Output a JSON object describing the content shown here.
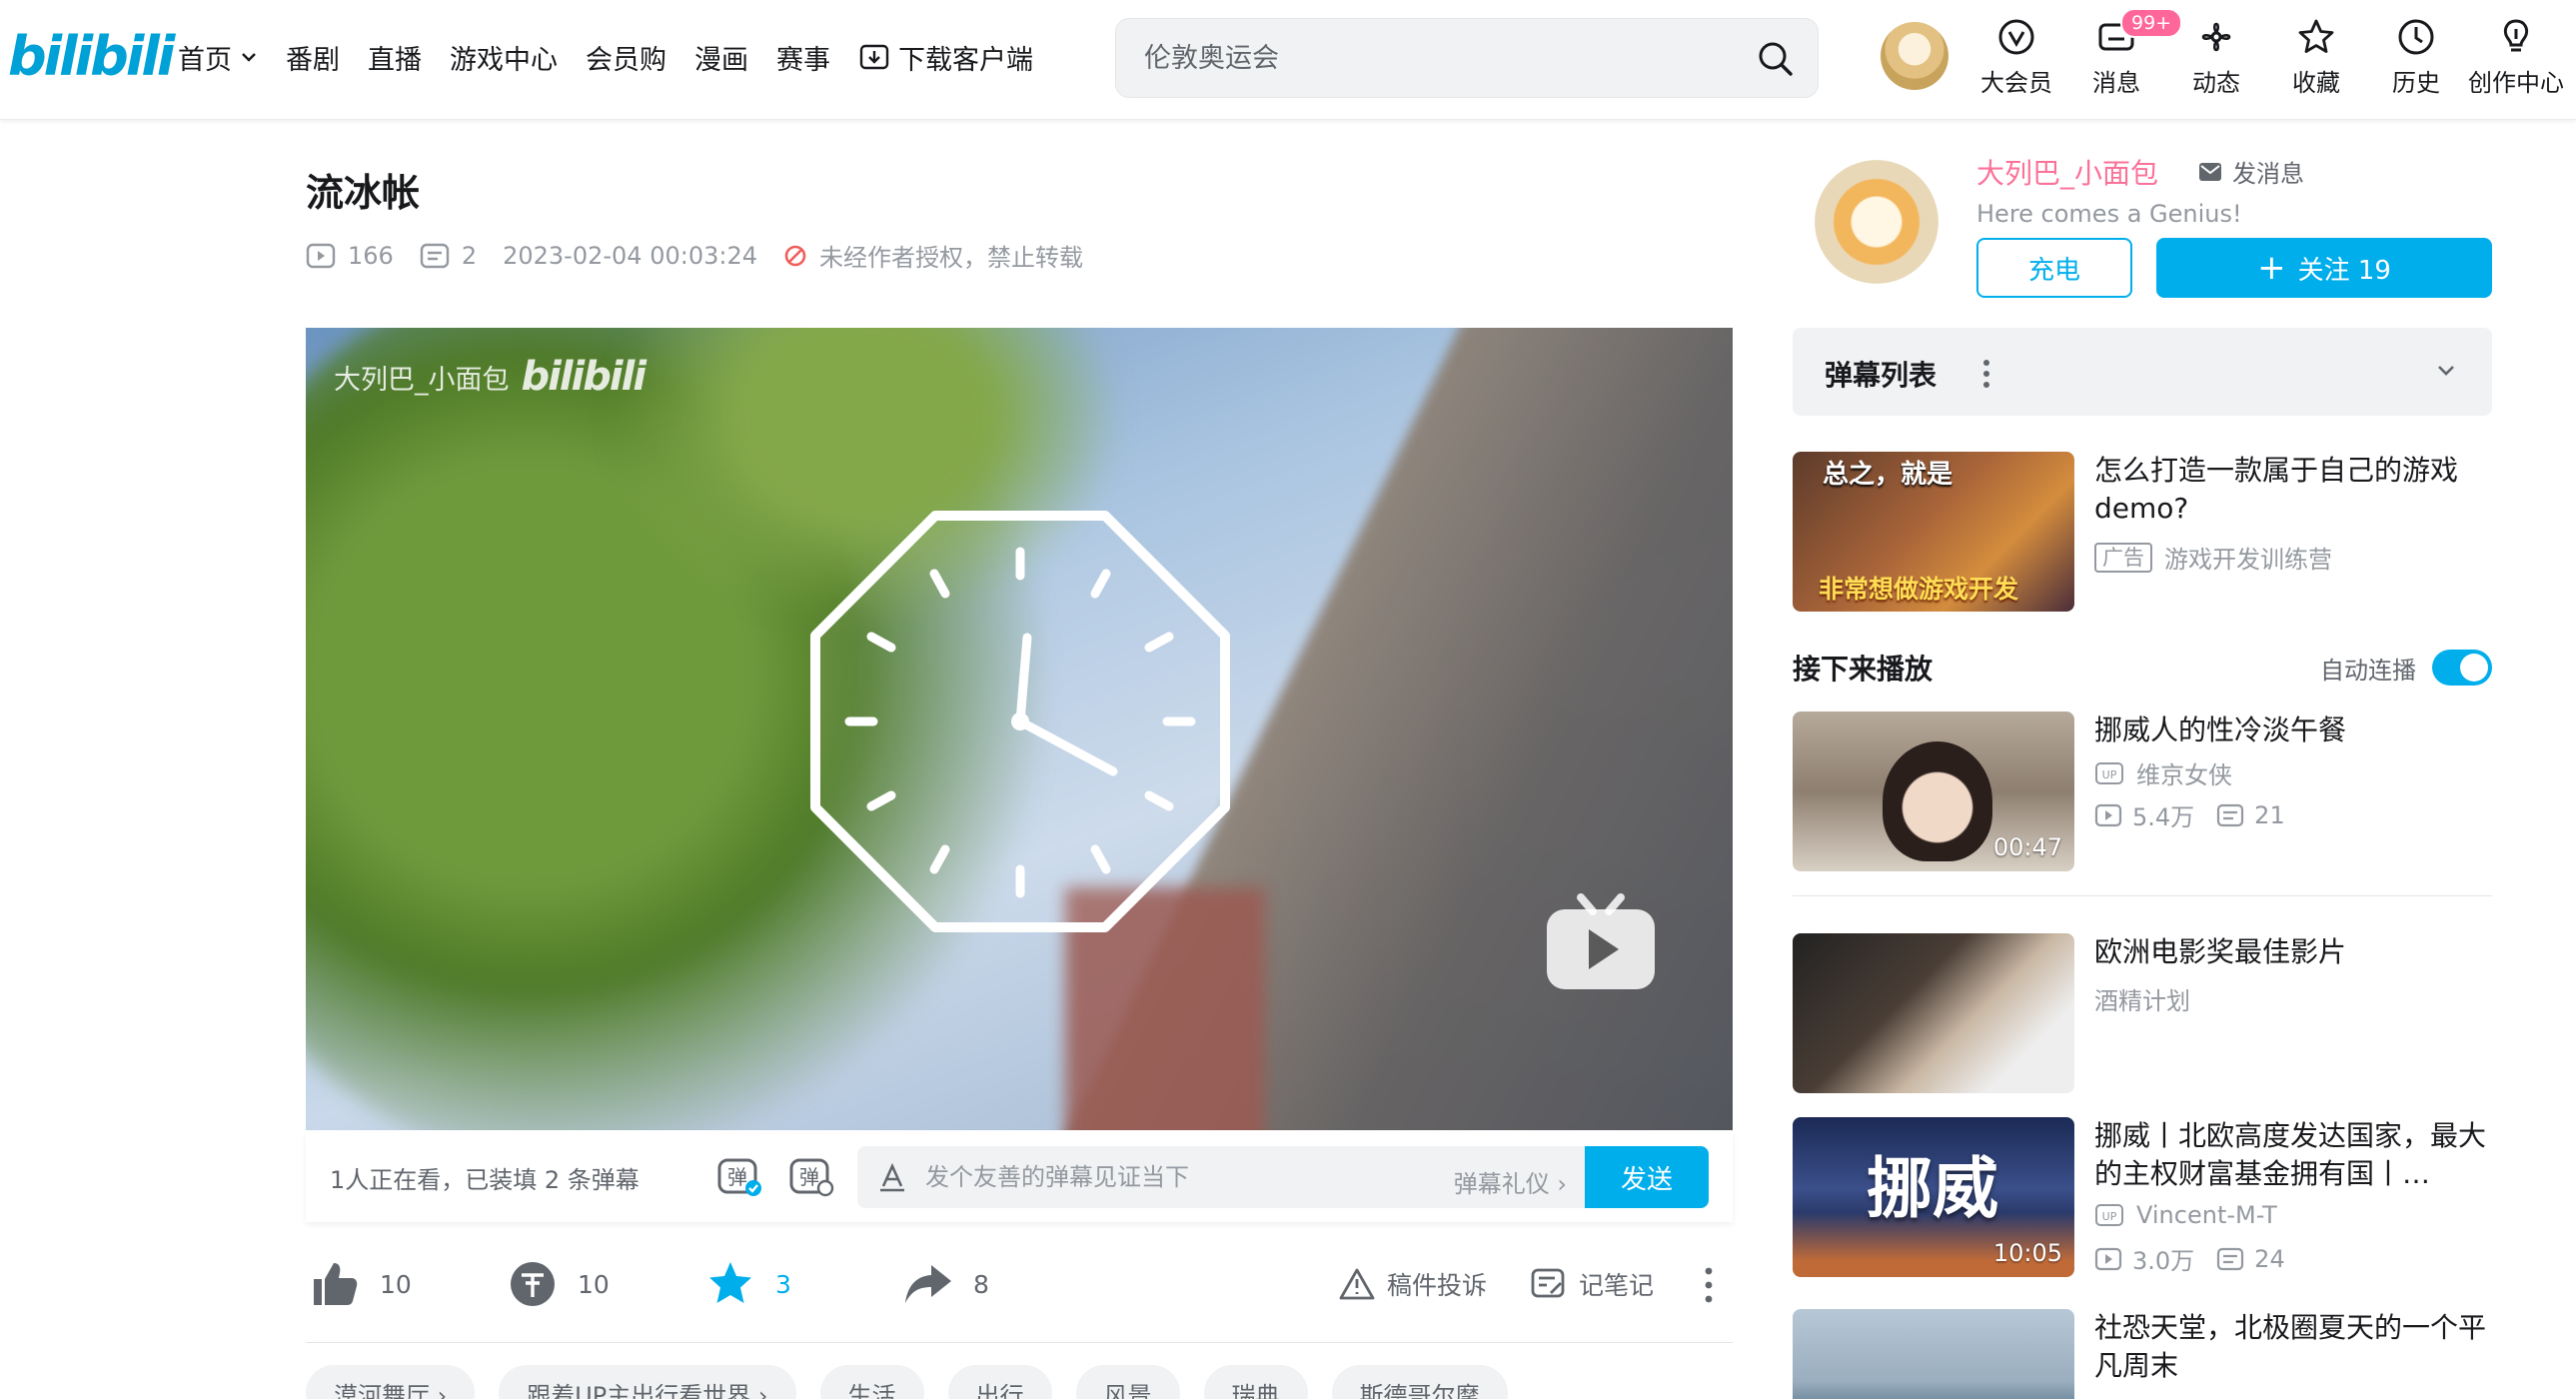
{
  "header": {
    "logo_text": "bilibili",
    "nav": [
      {
        "label": "首页",
        "has_dropdown": true
      },
      {
        "label": "番剧"
      },
      {
        "label": "直播"
      },
      {
        "label": "游戏中心"
      },
      {
        "label": "会员购"
      },
      {
        "label": "漫画"
      },
      {
        "label": "赛事"
      },
      {
        "label": "下载客户端",
        "icon": "download-icon"
      }
    ],
    "search_placeholder": "伦敦奥运会",
    "actions": [
      {
        "label": "大会员",
        "icon": "vip-icon"
      },
      {
        "label": "消息",
        "icon": "message-icon",
        "badge": "99+"
      },
      {
        "label": "动态",
        "icon": "dynamic-icon"
      },
      {
        "label": "收藏",
        "icon": "star-icon"
      },
      {
        "label": "历史",
        "icon": "clock-icon"
      },
      {
        "label": "创作中心",
        "icon": "bulb-icon"
      }
    ]
  },
  "video": {
    "title": "流冰帐",
    "views": "166",
    "danmaku_count": "2",
    "datetime": "2023-02-04 00:03:24",
    "copyright_notice": "未经作者授权，禁止转载",
    "watermark_name": "大列巴_小面包",
    "watermark_logo": "bilibili"
  },
  "danmaku_bar": {
    "viewers": "1人正在看，已装填 2 条弹幕",
    "input_placeholder": "发个友善的弹幕见证当下",
    "etiquette": "弹幕礼仪 ›",
    "send": "发送"
  },
  "toolbar": {
    "like": "10",
    "coin": "10",
    "favorite": "3",
    "share": "8",
    "report": "稿件投诉",
    "notes": "记笔记"
  },
  "tags": [
    "漠河舞厅 ›",
    "跟着UP主出行看世界 ›",
    "生活",
    "出行",
    "风景",
    "瑞典",
    "斯德哥尔摩"
  ],
  "uploader": {
    "name": "大列巴_小面包",
    "send_message": "发消息",
    "sign": "Here comes a Genius!",
    "charge": "充电",
    "follow": "关注 19"
  },
  "danmaku_list": {
    "title": "弹幕列表"
  },
  "ad": {
    "thumb_text_top": "总之，就是",
    "thumb_text_bottom": "非常想做游戏开发",
    "title": "怎么打造一款属于自己的游戏demo?",
    "tag": "广告",
    "source": "游戏开发训练营"
  },
  "next_up": {
    "heading": "接下来播放",
    "autoplay": "自动连播",
    "autoplay_on": true
  },
  "recommendations": [
    {
      "title": "挪威人的性冷淡午餐",
      "up": "维京女侠",
      "views": "5.4万",
      "danmaku": "21",
      "duration": "00:47"
    },
    {
      "title": "欧洲电影奖最佳影片",
      "up": "酒精计划"
    },
    {
      "title": "挪威丨北欧高度发达国家，最大的主权财富基金拥有国丨…",
      "thumb_text": "挪威",
      "up": "Vincent-M-T",
      "views": "3.0万",
      "danmaku": "24",
      "duration": "10:05"
    },
    {
      "title": "社恐天堂，北极圈夏天的一个平凡周末"
    }
  ],
  "colors": {
    "accent": "#00aeec",
    "pink": "#fb7299",
    "text": "#18191c",
    "muted": "#9499a0"
  }
}
